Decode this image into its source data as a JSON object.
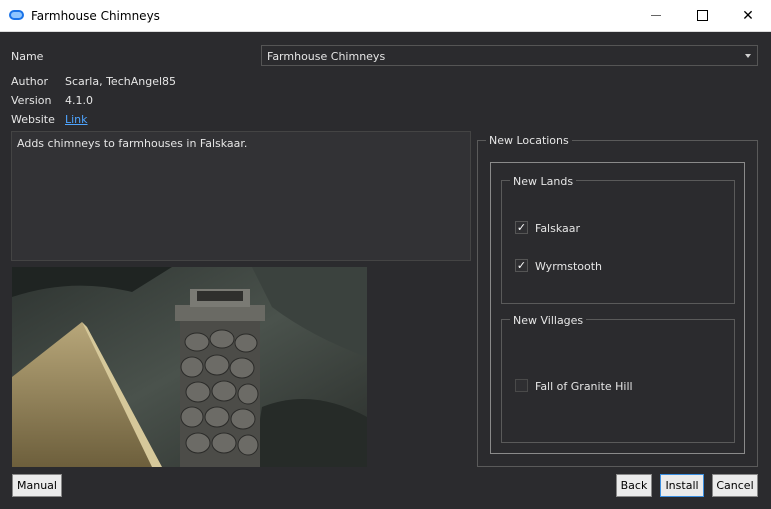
{
  "window": {
    "title": "Farmhouse Chimneys",
    "accent": "#1a73e8"
  },
  "fields": {
    "name_label": "Name",
    "name_value": "Farmhouse Chimneys",
    "author_label": "Author",
    "author_value": "Scarla, TechAngel85",
    "version_label": "Version",
    "version_value": "4.1.0",
    "website_label": "Website",
    "website_link": "Link",
    "description": "Adds chimneys to farmhouses in Falskaar."
  },
  "options": {
    "group_title": "New Locations",
    "lands_title": "New Lands",
    "lands": [
      {
        "label": "Falskaar",
        "checked": true
      },
      {
        "label": "Wyrmstooth",
        "checked": true
      }
    ],
    "villages_title": "New Villages",
    "villages": [
      {
        "label": "Fall of Granite Hill",
        "checked": false
      }
    ]
  },
  "buttons": {
    "manual": "Manual",
    "back": "Back",
    "install": "Install",
    "cancel": "Cancel"
  }
}
